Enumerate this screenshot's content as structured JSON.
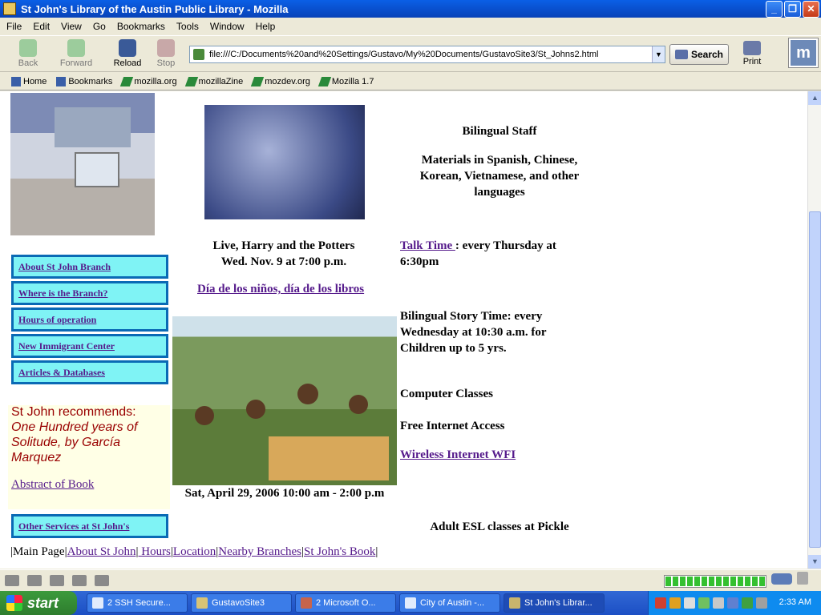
{
  "window": {
    "title": "St John's Library of the Austin Public Library - Mozilla"
  },
  "menu": [
    "File",
    "Edit",
    "View",
    "Go",
    "Bookmarks",
    "Tools",
    "Window",
    "Help"
  ],
  "toolbar": {
    "back": "Back",
    "forward": "Forward",
    "reload": "Reload",
    "stop": "Stop",
    "url": "file:///C:/Documents%20and%20Settings/Gustavo/My%20Documents/GustavoSite3/St_Johns2.html",
    "search": "Search",
    "print": "Print"
  },
  "bookmarks": [
    "Home",
    "Bookmarks",
    "mozilla.org",
    "mozillaZine",
    "mozdev.org",
    "Mozilla 1.7"
  ],
  "page": {
    "nav": [
      "About St John Branch",
      "Where is the Branch?",
      "Hours of operation",
      "New Immigrant Center",
      "Articles & Databases"
    ],
    "recommend_heading": "St John recommends:",
    "recommend_book": "One Hundred years of Solitude, by García Marquez",
    "abstract_link": "Abstract of Book",
    "other_services": "Other Services at St John's",
    "bilingual_staff": "Bilingual Staff",
    "materials": "Materials in Spanish, Chinese, Korean, Vietnamese, and other languages",
    "event_title": "Live, Harry and the Potters",
    "event_date": "Wed. Nov. 9 at 7:00 p.m.",
    "talk_time_link": "Talk Time ",
    "talk_time_rest": ": every Thursday at 6:30pm",
    "dia_link": "Día de los niños, día de los libros",
    "story_time": "Bilingual Story Time: every Wednesday at 10:30 a.m. for Children up to 5 yrs.",
    "computer_classes": "Computer Classes",
    "free_internet": "Free Internet Access",
    "wireless_link": "Wireless Internet WFI",
    "dia_date": "Sat, April 29, 2006 10:00 am - 2:00 p.m",
    "esl": "Adult ESL classes at Pickle",
    "footer": {
      "main": "Main Page",
      "links": [
        "About St John",
        " Hours",
        "Location",
        "Nearby Branches",
        "St John's Book"
      ]
    }
  },
  "taskbar": {
    "start": "start",
    "tasks": [
      "2 SSH Secure...",
      "GustavoSite3",
      "2 Microsoft O...",
      "City of Austin -...",
      "St John's Librar..."
    ],
    "clock": "2:33 AM"
  },
  "progress": {
    "filled_fraction": 1.0
  }
}
